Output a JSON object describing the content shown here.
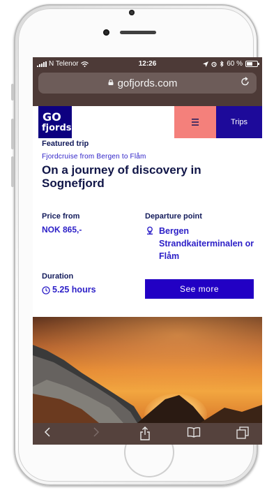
{
  "status_bar": {
    "carrier": "N Telenor",
    "time": "12:26",
    "battery_percent": "60 %"
  },
  "browser": {
    "url": "gofjords.com"
  },
  "header": {
    "logo_top": "GO",
    "logo_bottom": "fjords",
    "menu_icon": "hamburger-icon",
    "trips_label": "Trips"
  },
  "featured": {
    "label": "Featured trip",
    "route": "Fjordcruise from Bergen to Flåm",
    "title": "On a journey of discovery in Sognefjord",
    "price_heading": "Price from",
    "price_value": "NOK 865,-",
    "departure_heading": "Departure point",
    "departure_value": "Bergen Strandkaiterminalen or Flåm",
    "duration_heading": "Duration",
    "duration_value": "5.25 hours",
    "cta_label": "See more"
  },
  "colors": {
    "brand_navy": "#0d0080",
    "accent_coral": "#f4807b",
    "accent_blue": "#2200c4"
  }
}
